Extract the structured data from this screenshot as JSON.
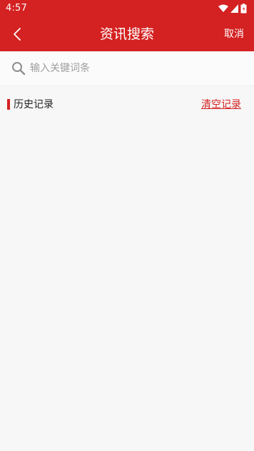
{
  "status_bar": {
    "time": "4:57",
    "icons": [
      "wifi-icon",
      "cell-signal-icon",
      "battery-icon"
    ]
  },
  "app_bar": {
    "back_icon": "chevron-left-icon",
    "title": "资讯搜索",
    "cancel_label": "取消"
  },
  "search": {
    "icon": "search-icon",
    "placeholder": "输入关键词条",
    "value": ""
  },
  "history": {
    "title": "历史记录",
    "clear_label": "清空记录",
    "items": []
  },
  "colors": {
    "accent": "#d42121",
    "background": "#f7f7f7",
    "placeholder": "#9e9e9e"
  }
}
